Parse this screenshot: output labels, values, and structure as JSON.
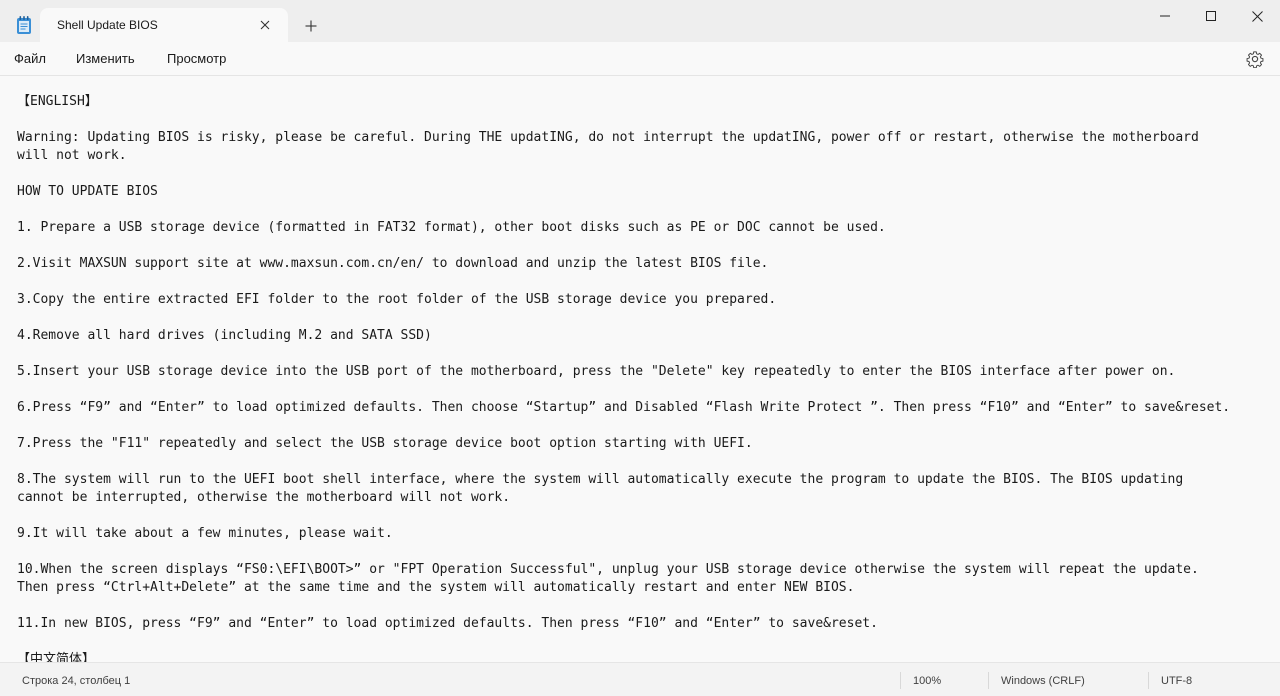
{
  "window": {
    "tab_title": "Shell Update BIOS"
  },
  "menu": {
    "file": "Файл",
    "edit": "Изменить",
    "view": "Просмотр"
  },
  "document": {
    "lines": [
      "【ENGLISH】",
      "",
      "Warning: Updating BIOS is risky, please be careful. During THE updatING, do not interrupt the updatING, power off or restart, otherwise the motherboard",
      "will not work.",
      "",
      "HOW TO UPDATE BIOS",
      "",
      "1. Prepare a USB storage device (formatted in FAT32 format), other boot disks such as PE or DOC cannot be used.",
      "",
      "2.Visit MAXSUN support site at www.maxsun.com.cn/en/ to download and unzip the latest BIOS file.",
      "",
      "3.Copy the entire extracted EFI folder to the root folder of the USB storage device you prepared.",
      "",
      "4.Remove all hard drives (including M.2 and SATA SSD)",
      "",
      "5.Insert your USB storage device into the USB port of the motherboard, press the \"Delete\" key repeatedly to enter the BIOS interface after power on.",
      "",
      "6.Press “F9” and “Enter” to load optimized defaults. Then choose “Startup” and Disabled “Flash Write Protect ”. Then press “F10” and “Enter” to save&reset.",
      "",
      "7.Press the \"F11\" repeatedly and select the USB storage device boot option starting with UEFI.",
      "",
      "8.The system will run to the UEFI boot shell interface, where the system will automatically execute the program to update the BIOS. The BIOS updating",
      "cannot be interrupted, otherwise the motherboard will not work.",
      "",
      "9.It will take about a few minutes, please wait.",
      "",
      "10.When the screen displays “FS0:\\EFI\\BOOT>” or \"FPT Operation Successful\", unplug your USB storage device otherwise the system will repeat the update.",
      "Then press “Ctrl+Alt+Delete” at the same time and the system will automatically restart and enter NEW BIOS.",
      "",
      "11.In new BIOS, press “F9” and “Enter” to load optimized defaults. Then press “F10” and “Enter” to save&reset.",
      "",
      "【中文简体】"
    ]
  },
  "status": {
    "position": "Строка 24, столбец 1",
    "zoom": "100%",
    "line_endings": "Windows (CRLF)",
    "encoding": "UTF-8"
  }
}
